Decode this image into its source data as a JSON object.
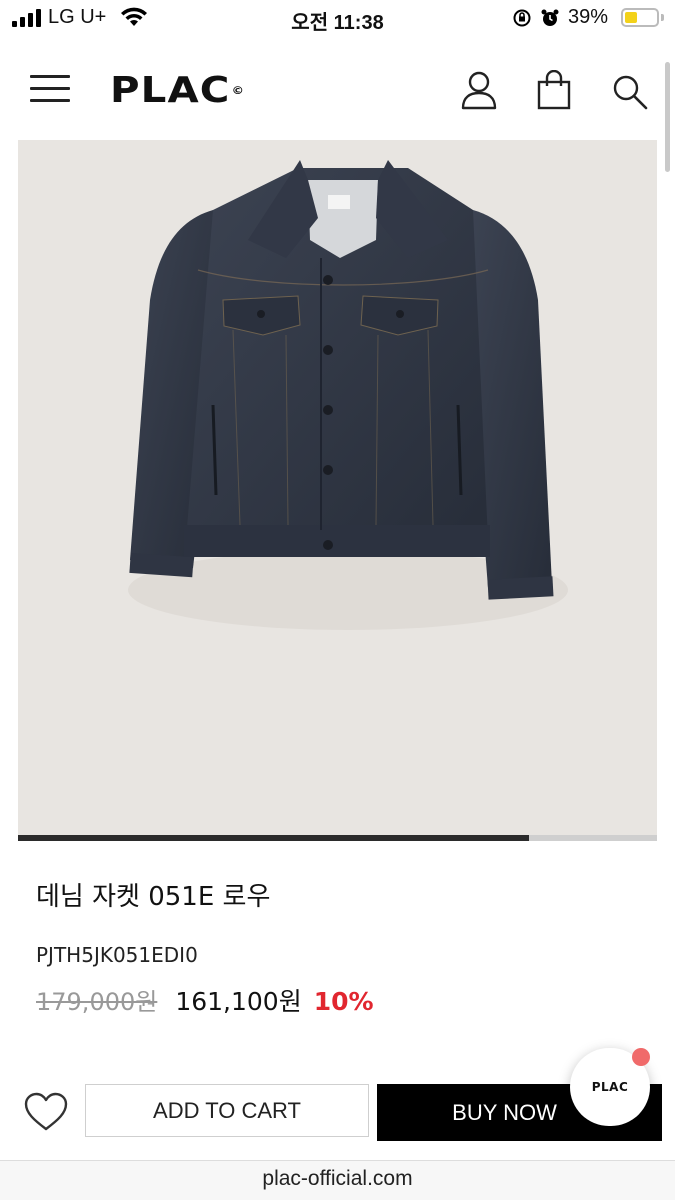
{
  "status_bar": {
    "carrier": "LG U+",
    "time": "오전 11:38",
    "battery_percent": "39%",
    "battery_level": 0.39,
    "icons": [
      "signal-icon",
      "wifi-icon",
      "orientation-lock-icon",
      "alarm-icon",
      "battery-icon"
    ]
  },
  "header": {
    "logo": "PLAC",
    "logo_mark": "©",
    "icons": [
      "menu-icon",
      "user-icon",
      "shopping-bag-icon",
      "search-icon"
    ]
  },
  "product": {
    "image": "denim-jacket-photo",
    "carousel_progress": 0.8,
    "name": "데님 자켓 051E 로우",
    "code": "PJTH5JK051EDI0",
    "original_price": "179,000원",
    "sale_price": "161,100원",
    "discount": "10%"
  },
  "actions": {
    "add_to_cart": "ADD TO CART",
    "buy_now": "BUY NOW",
    "chat_logo": "PLAC",
    "wishlist_icon": "heart-icon"
  },
  "browser": {
    "url": "plac-official.com"
  },
  "colors": {
    "accent_discount": "#e1262f",
    "buy_button": "#000000",
    "image_background": "#e8e5e1",
    "chat_badge": "#f06a6a"
  }
}
